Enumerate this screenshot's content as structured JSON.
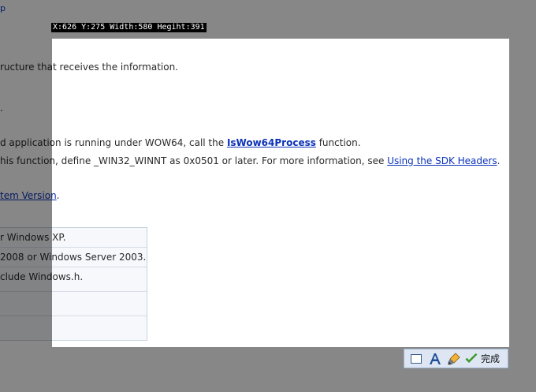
{
  "page": {
    "top_link": "p",
    "line1": "ructure that receives the information.",
    "line2": ".",
    "line3_prefix": "d application is running under WOW64, call the ",
    "line3_link": "IsWow64Process",
    "line3_suffix": " function.",
    "line4_prefix": "his function, define _WIN32_WINNT as 0x0501 or later. For more information, see ",
    "line4_link": "Using the SDK Headers",
    "line4_suffix": ".",
    "line5_link": "tem Version",
    "line5_suffix": ".",
    "requirements": [
      "r Windows XP.",
      " 2008 or Windows Server 2003.",
      "clude Windows.h.",
      "",
      ""
    ]
  },
  "capture": {
    "readout": "X:626 Y:275 Width:580 Hegiht:391"
  },
  "toolbar": {
    "rect_icon": "rectangle-icon",
    "text_icon": "text-icon",
    "brush_icon": "brush-icon",
    "done_icon": "checkmark-icon",
    "done_label": "完成",
    "check_color": "#3a9a2a"
  }
}
